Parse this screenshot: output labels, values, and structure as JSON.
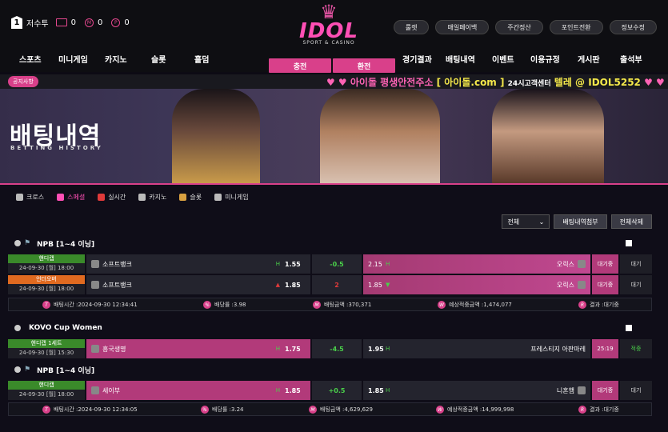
{
  "header": {
    "level": "1",
    "username": "저수투",
    "mail_count": "0",
    "m_label": "M",
    "m_value": "0",
    "p_label": "P",
    "p_value": "0",
    "logo": {
      "text": "IDOL",
      "sub": "SPORT & CASINO"
    },
    "top_buttons": [
      "룰렛",
      "매일페이백",
      "주간정산",
      "포인트전환",
      "정보수정"
    ]
  },
  "nav": {
    "items": [
      "스포츠",
      "미니게임",
      "카지노",
      "슬롯",
      "홀덤",
      "경기결과",
      "배팅내역",
      "이벤트",
      "이용규정",
      "게시판",
      "출석부"
    ],
    "charge": "충전",
    "withdraw": "환전"
  },
  "notice": {
    "tag": "공지사항",
    "prefix": "♥ ♥  아이돌 평생안전주소",
    "address": "[ 아이돌.com ]",
    "middle": "24시고객센터",
    "telegram": "텔레 @ IDOL5252",
    "suffix": "♥ ♥"
  },
  "banner": {
    "title": "배팅내역",
    "subtitle": "BETTING HISTORY"
  },
  "tabs": [
    "크로스",
    "스페셜",
    "실시간",
    "카지노",
    "슬롯",
    "미니게임"
  ],
  "controls": {
    "select": "전체",
    "btn1": "배팅내역첨부",
    "btn2": "전체삭제"
  },
  "cards": [
    {
      "league": "NPB [1~4 이닝]",
      "rows": [
        {
          "type": "핸디캡",
          "type_color": "#3a8a2a",
          "date": "24-09-30 [월] 18:00",
          "home": "소프트뱅크",
          "home_mark": "H",
          "home_odd": "1.55",
          "mid": "-0.5",
          "mid_color": "#4ad04a",
          "away_odd": "2.15",
          "away_mark": "H",
          "away": "오릭스",
          "result": "대기중",
          "status": "대기"
        },
        {
          "type": "언더오버",
          "type_color": "#e06a20",
          "date": "24-09-30 [월] 18:00",
          "home": "소프트뱅크",
          "home_mark": "▲",
          "home_odd": "1.85",
          "mid": "2",
          "mid_color": "#e03a3a",
          "away_odd": "1.85",
          "away_mark": "▼",
          "away": "오릭스",
          "result": "대기중",
          "status": "대기"
        }
      ],
      "info": {
        "time": "배팅시간 :2024-09-30 12:34:41",
        "rate": "배당률 :3.98",
        "amount": "배팅금액 :370,371",
        "expect": "예상적중금액 :1,474,077",
        "result": "결과 :대기중"
      }
    },
    {
      "league": "KOVO Cup Women",
      "rows": [
        {
          "type": "핸디캡 1세트",
          "type_color": "#3a8a2a",
          "date": "24-09-30 [월] 15:30",
          "home": "흥국생명",
          "home_mark": "H",
          "home_odd": "1.75",
          "mid": "-4.5",
          "mid_color": "#4ad04a",
          "away_odd": "1.95",
          "away_mark": "H",
          "away": "프레스티지 아판마레",
          "result": "25:19",
          "status": "적중"
        }
      ]
    },
    {
      "league": "NPB [1~4 이닝]",
      "rows": [
        {
          "type": "핸디캡",
          "type_color": "#3a8a2a",
          "date": "24-09-30 [월] 18:00",
          "home": "세이부",
          "home_mark": "H",
          "home_odd": "1.85",
          "mid": "+0.5",
          "mid_color": "#4ad04a",
          "away_odd": "1.85",
          "away_mark": "H",
          "away": "니혼햄",
          "result": "대기중",
          "status": "대기"
        }
      ],
      "info": {
        "time": "배팅시간 :2024-09-30 12:34:05",
        "rate": "배당률 :3.24",
        "amount": "배팅금액 :4,629,629",
        "expect": "예상적중금액 :14,999,998",
        "result": "결과 :대기중"
      }
    }
  ]
}
